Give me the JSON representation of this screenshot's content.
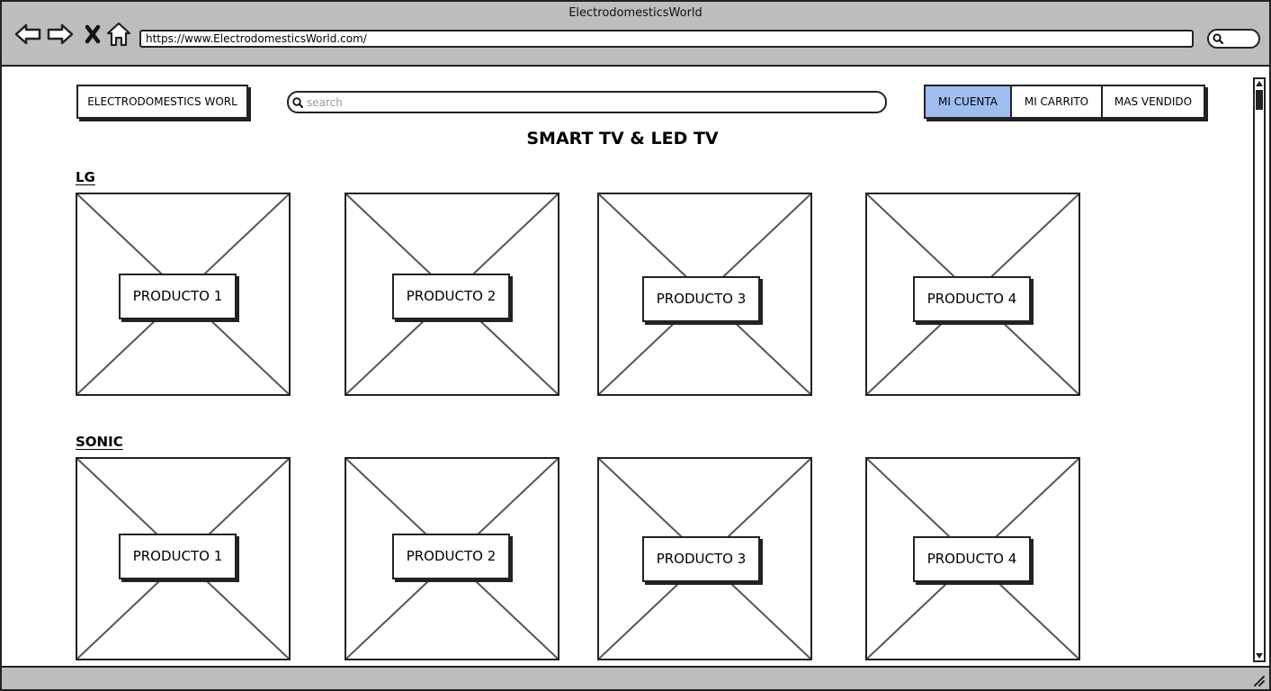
{
  "browser": {
    "window_title": "ElectrodomesticsWorld",
    "url": "https://www.ElectrodomesticsWorld.com/"
  },
  "header": {
    "logo_text": "ELECTRODOMESTICS WORL",
    "search_placeholder": "search",
    "nav": [
      {
        "label": "MI CUENTA",
        "active": true
      },
      {
        "label": "MI CARRITO",
        "active": false
      },
      {
        "label": "MAS VENDIDO",
        "active": false
      }
    ]
  },
  "main": {
    "heading": "SMART TV & LED TV",
    "sections": [
      {
        "title": "LG",
        "products": [
          "PRODUCTO 1",
          "PRODUCTO 2",
          "PRODUCTO 3",
          "PRODUCTO 4"
        ]
      },
      {
        "title": "SONIC",
        "products": [
          "PRODUCTO 1",
          "PRODUCTO 2",
          "PRODUCTO 3",
          "PRODUCTO 4"
        ]
      }
    ]
  },
  "colors": {
    "active_tab": "#a0bdf0",
    "chrome": "#bdbdbd",
    "stroke": "#222222"
  }
}
